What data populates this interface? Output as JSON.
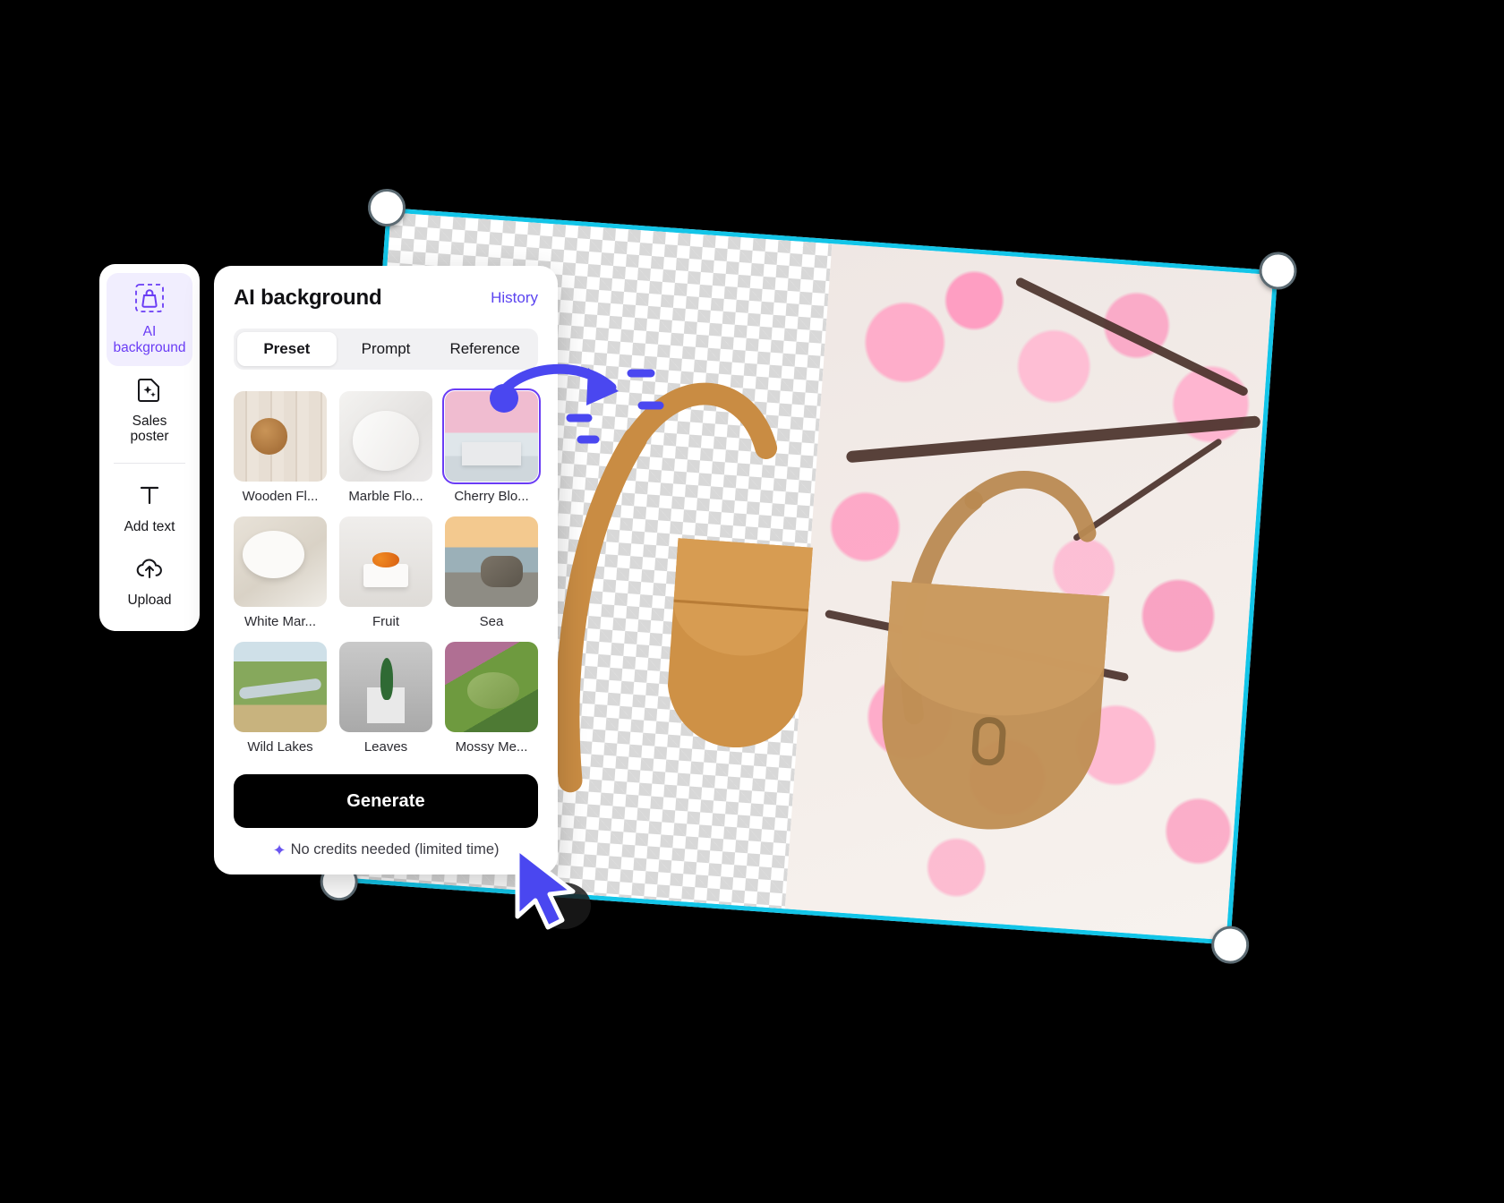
{
  "sidebar": {
    "items": [
      {
        "label": "AI background",
        "icon": "bag-selection-icon",
        "active": true
      },
      {
        "label": "Sales poster",
        "icon": "sparkle-document-icon",
        "active": false
      },
      {
        "label": "Add text",
        "icon": "text-tool-icon",
        "active": false
      },
      {
        "label": "Upload",
        "icon": "cloud-upload-icon",
        "active": false
      }
    ]
  },
  "panel": {
    "title": "AI background",
    "history_label": "History",
    "tabs": [
      {
        "label": "Preset",
        "active": true
      },
      {
        "label": "Prompt",
        "active": false
      },
      {
        "label": "Reference",
        "active": false
      }
    ],
    "presets": [
      {
        "label": "Wooden Fl...",
        "art": "t-wooden",
        "selected": false
      },
      {
        "label": "Marble Flo...",
        "art": "t-marble",
        "selected": false
      },
      {
        "label": "Cherry Blo...",
        "art": "t-cherry",
        "selected": true
      },
      {
        "label": "White Mar...",
        "art": "t-white",
        "selected": false
      },
      {
        "label": "Fruit",
        "art": "t-fruit",
        "selected": false
      },
      {
        "label": "Sea",
        "art": "t-sea",
        "selected": false
      },
      {
        "label": "Wild Lakes",
        "art": "t-lakes",
        "selected": false
      },
      {
        "label": "Leaves",
        "art": "t-leaves",
        "selected": false
      },
      {
        "label": "Mossy Me...",
        "art": "t-mossy",
        "selected": false
      }
    ],
    "generate_label": "Generate",
    "credits_note": "No credits needed (limited time)",
    "sparkle_glyph": "✦"
  },
  "canvas": {
    "selection_color": "#12C5E8",
    "handle_color": "#ffffff",
    "subject": "tan-leather-saddle-bag",
    "background_preview": "cherry-blossom-branches"
  },
  "theme": {
    "accent_purple": "#6A3CF5",
    "link_purple": "#5B44F0",
    "cyan": "#12C5E8",
    "button_black": "#000000"
  }
}
